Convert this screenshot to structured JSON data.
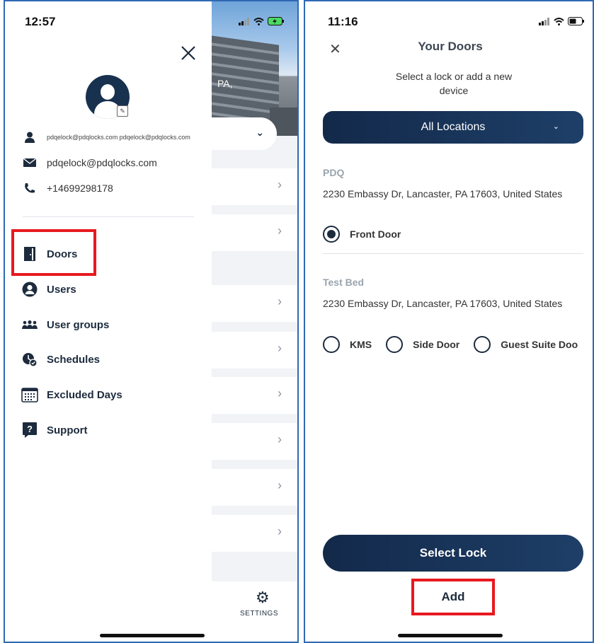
{
  "left": {
    "status_time": "12:57",
    "background": {
      "location_fragment": "PA,",
      "settings_label": "SETTINGS"
    },
    "drawer": {
      "user_small": "pdqelock@pdqlocks.com pdqelock@pdqlocks.com",
      "email": "pdqelock@pdqlocks.com",
      "phone": "+14699298178",
      "menu": [
        {
          "label": "Doors",
          "icon": "door-icon"
        },
        {
          "label": "Users",
          "icon": "user-circle-icon"
        },
        {
          "label": "User groups",
          "icon": "user-group-icon"
        },
        {
          "label": "Schedules",
          "icon": "schedule-icon"
        },
        {
          "label": "Excluded Days",
          "icon": "calendar-icon"
        },
        {
          "label": "Support",
          "icon": "help-icon"
        }
      ]
    }
  },
  "right": {
    "status_time": "11:16",
    "title": "Your Doors",
    "subtitle": "Select a lock or add a new device",
    "location_select": "All Locations",
    "groups": [
      {
        "name": "PDQ",
        "address": "2230 Embassy Dr,  Lancaster,  PA  17603, United States",
        "doors": [
          {
            "label": "Front Door",
            "selected": true
          }
        ]
      },
      {
        "name": "Test Bed",
        "address": "2230 Embassy Dr,  Lancaster,  PA  17603, United States",
        "doors": [
          {
            "label": "KMS",
            "selected": false
          },
          {
            "label": "Side Door",
            "selected": false
          },
          {
            "label": "Guest Suite Doo",
            "selected": false
          }
        ]
      }
    ],
    "select_lock_label": "Select Lock",
    "add_label": "Add"
  },
  "colors": {
    "navy": "#17314f",
    "highlight_red": "#e8191f",
    "frame_blue": "#2f69b5"
  }
}
